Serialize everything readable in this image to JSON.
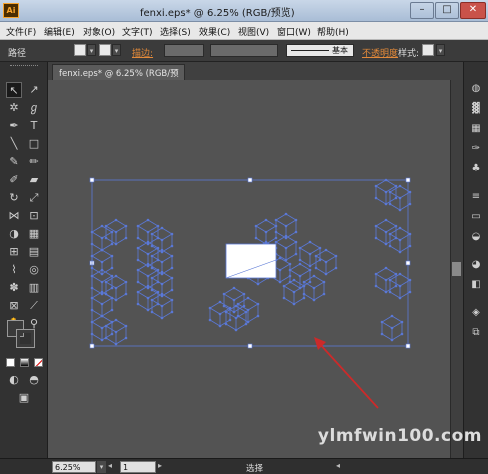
{
  "window": {
    "app_logo": "Ai",
    "title": "fenxi.eps* @ 6.25% (RGB/预览)"
  },
  "menu": [
    "文件(F)",
    "编辑(E)",
    "对象(O)",
    "文字(T)",
    "选择(S)",
    "效果(C)",
    "视图(V)",
    "窗口(W)",
    "帮助(H)"
  ],
  "control": {
    "path_label": "路径",
    "stroke_label": "描边:",
    "stroke_style": "基本",
    "opacity_label": "不透明度",
    "style_label": "样式:"
  },
  "tab": {
    "label": "fenxi.eps* @ 6.25% (RGB/预览)"
  },
  "status": {
    "zoom": "6.25%",
    "page": "1",
    "tool": "选择"
  },
  "watermark": "ylmfwin100.com",
  "colors": {
    "selection": "#5a78d6",
    "arrow": "#cc2a2a",
    "highlight": "#ff7a3a"
  }
}
